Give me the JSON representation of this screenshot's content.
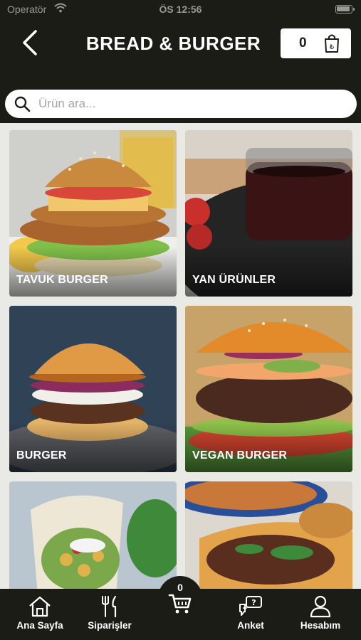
{
  "status_bar": {
    "carrier": "Operatör",
    "time": "ÖS 12:56"
  },
  "header": {
    "title": "BREAD & BURGER",
    "cart_count": "0"
  },
  "search": {
    "placeholder": "Ürün ara..."
  },
  "categories": [
    {
      "label": "TAVUK BURGER"
    },
    {
      "label": "YAN ÜRÜNLER"
    },
    {
      "label": "BURGER"
    },
    {
      "label": "VEGAN BURGER"
    },
    {
      "label": ""
    },
    {
      "label": ""
    }
  ],
  "tab_bar": {
    "home": "Ana Sayfa",
    "orders": "Siparişler",
    "cart_count": "0",
    "survey": "Anket",
    "account": "Hesabım"
  },
  "colors": {
    "dark": "#1b1c16",
    "white": "#ffffff",
    "placeholder": "#a6a6a6"
  }
}
